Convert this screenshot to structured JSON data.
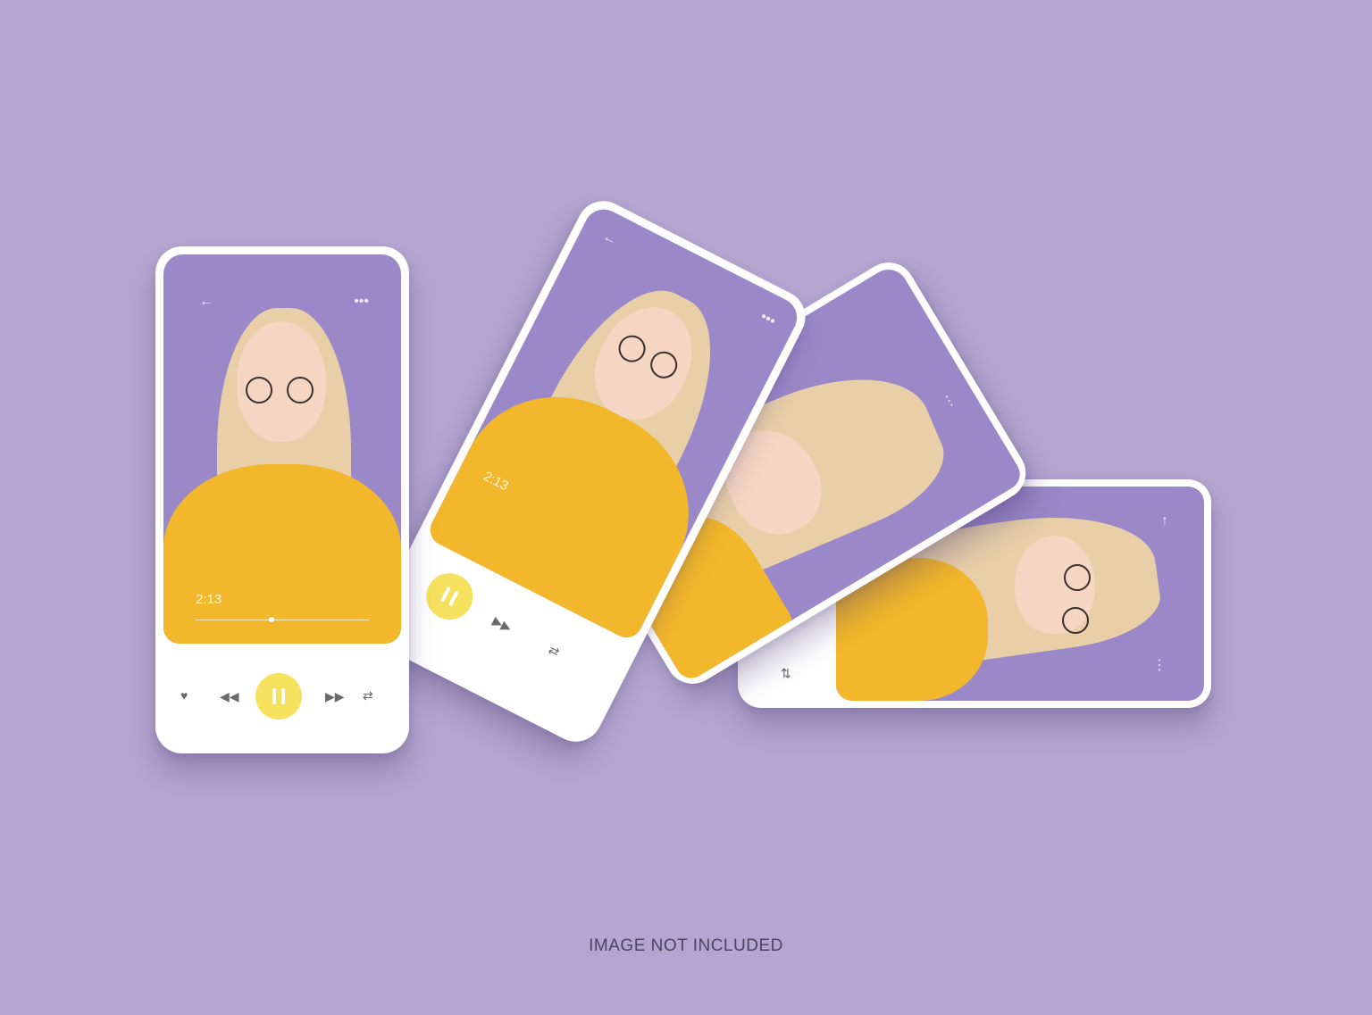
{
  "caption": "IMAGE NOT INCLUDED",
  "player": {
    "time": "2:13",
    "icons": {
      "back": "back-arrow-icon",
      "menu": "more-icon",
      "like": "heart-icon",
      "rewind": "rewind-icon",
      "pause": "pause-icon",
      "forward": "fast-forward-icon",
      "repeat": "repeat-icon"
    }
  },
  "colors": {
    "background": "#b4a6d0",
    "screen": "#9a88c8",
    "accent": "#f6e15e",
    "sweater": "#f2b72b"
  }
}
